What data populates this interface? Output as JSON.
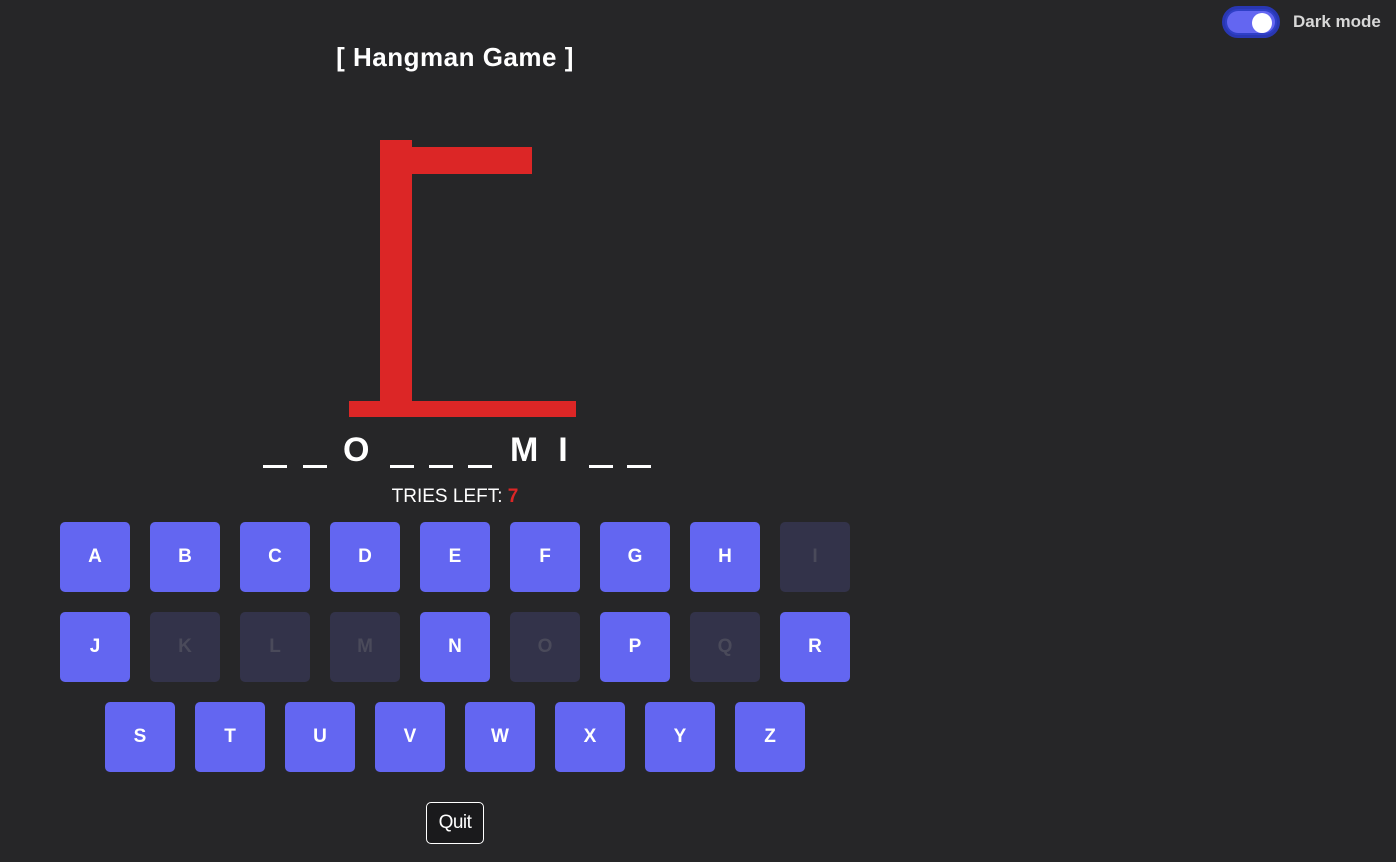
{
  "header": {
    "title": "[ Hangman Game ]",
    "dark_mode_label": "Dark mode",
    "dark_mode_on": true
  },
  "word": {
    "slots": [
      "",
      "",
      "O",
      "",
      "",
      "",
      "M",
      "I",
      "",
      ""
    ]
  },
  "status": {
    "tries_label": "TRIES LEFT:",
    "tries_left": "7"
  },
  "keyboard": {
    "rows": [
      [
        {
          "letter": "A",
          "used": false
        },
        {
          "letter": "B",
          "used": false
        },
        {
          "letter": "C",
          "used": false
        },
        {
          "letter": "D",
          "used": false
        },
        {
          "letter": "E",
          "used": false
        },
        {
          "letter": "F",
          "used": false
        },
        {
          "letter": "G",
          "used": false
        },
        {
          "letter": "H",
          "used": false
        },
        {
          "letter": "I",
          "used": true
        }
      ],
      [
        {
          "letter": "J",
          "used": false
        },
        {
          "letter": "K",
          "used": true
        },
        {
          "letter": "L",
          "used": true
        },
        {
          "letter": "M",
          "used": true
        },
        {
          "letter": "N",
          "used": false
        },
        {
          "letter": "O",
          "used": true
        },
        {
          "letter": "P",
          "used": false
        },
        {
          "letter": "Q",
          "used": true
        },
        {
          "letter": "R",
          "used": false
        }
      ],
      [
        {
          "letter": "S",
          "used": false
        },
        {
          "letter": "T",
          "used": false
        },
        {
          "letter": "U",
          "used": false
        },
        {
          "letter": "V",
          "used": false
        },
        {
          "letter": "W",
          "used": false
        },
        {
          "letter": "X",
          "used": false
        },
        {
          "letter": "Y",
          "used": false
        },
        {
          "letter": "Z",
          "used": false
        }
      ]
    ]
  },
  "actions": {
    "quit_label": "Quit"
  },
  "colors": {
    "background": "#262628",
    "accent": "#6366f1",
    "key_used": "#33334a",
    "gallows": "#dc2626",
    "tries_count": "#dc2626"
  }
}
